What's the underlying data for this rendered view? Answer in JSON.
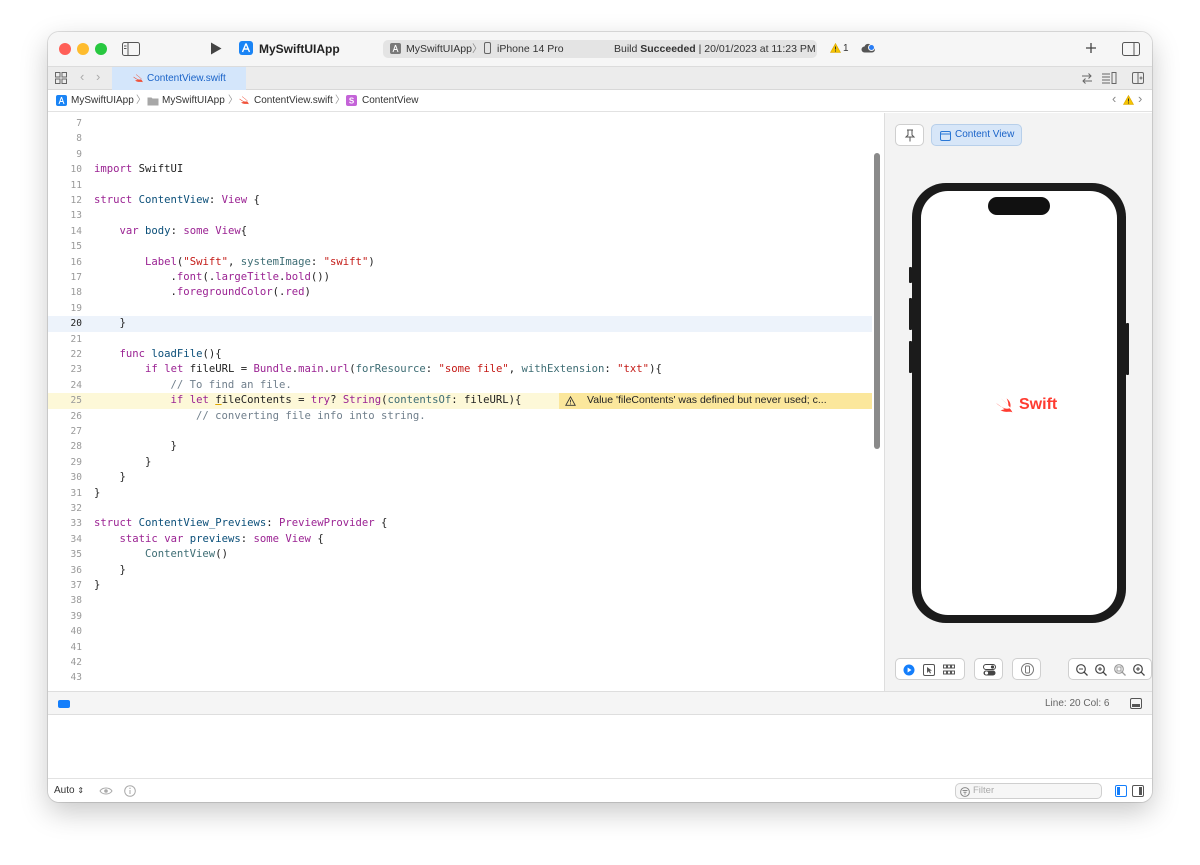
{
  "toolbar": {
    "scheme_name": "MySwiftUIApp",
    "run_target": "MySwiftUIApp",
    "device": "iPhone 14 Pro",
    "status_prefix": "Build ",
    "status_bold": "Succeeded",
    "status_suffix": " | 20/01/2023 at 11:23 PM",
    "warning_count": "1"
  },
  "tab": {
    "label": "ContentView.swift"
  },
  "jumpbar": {
    "items": [
      "MySwiftUIApp",
      "MySwiftUIApp",
      "ContentView.swift",
      "ContentView"
    ]
  },
  "editor": {
    "current_line": 20,
    "warning_line": 25,
    "line_numbers": [
      "7",
      "8",
      "9",
      "10",
      "11",
      "12",
      "13",
      "14",
      "15",
      "16",
      "17",
      "18",
      "19",
      "20",
      "21",
      "22",
      "23",
      "24",
      "25",
      "26",
      "27",
      "28",
      "29",
      "30",
      "31",
      "32",
      "33",
      "34",
      "35",
      "36",
      "37",
      "38",
      "39",
      "40",
      "41",
      "42",
      "43"
    ],
    "warning_text": "Value 'fileContents' was defined but never used; c..."
  },
  "canvas": {
    "preview_button": "Content View",
    "preview_text": "Swift",
    "preview_color": "#ff3b30"
  },
  "debug": {
    "cursor_pos": "Line: 20  Col: 6"
  },
  "bottom": {
    "output_select": "Auto",
    "filter_placeholder": "Filter"
  },
  "colors": {
    "accent": "#147efb",
    "keyword": "#9b2393",
    "string": "#c41a16",
    "warning": "#fbe79c"
  }
}
